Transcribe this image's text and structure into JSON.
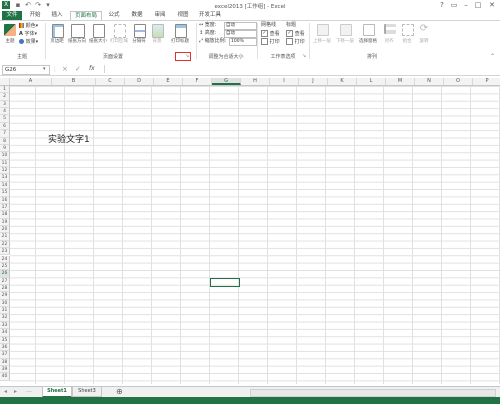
{
  "window": {
    "title": "excel2013 [工作组] - Excel",
    "quick_access": [
      "save-icon",
      "undo-icon",
      "redo-icon",
      "customize-icon"
    ],
    "controls": [
      "help-icon",
      "ribbon-display-icon",
      "minimize-icon",
      "restore-icon",
      "close-icon"
    ]
  },
  "tabs": {
    "file": "文件",
    "items": [
      "开始",
      "插入",
      "页面布局",
      "公式",
      "数据",
      "审阅",
      "视图",
      "开发工具"
    ],
    "active": "页面布局"
  },
  "ribbon": {
    "themes": {
      "label": "主题",
      "big_button": "主题",
      "colors": "颜色",
      "fonts": "字体",
      "effects": "效果"
    },
    "page_setup": {
      "label": "页面设置",
      "margins": "页边距",
      "orientation": "纸张方向",
      "size": "纸张大小",
      "print_area": "打印区域",
      "breaks": "分隔符",
      "background": "背景",
      "print_titles": "打印标题"
    },
    "scale_to_fit": {
      "label": "调整为合适大小",
      "width_label": "宽度:",
      "width_value": "自动",
      "height_label": "高度:",
      "height_value": "自动",
      "scale_label": "缩放比例:",
      "scale_value": "100%"
    },
    "sheet_options": {
      "label": "工作表选项",
      "gridlines": "网格线",
      "headings": "标题",
      "view": "查看",
      "print": "打印",
      "gridlines_view": true,
      "headings_view": true,
      "gridlines_print": false,
      "headings_print": false
    },
    "arrange": {
      "label": "排列",
      "bring_forward": "上移一层",
      "send_backward": "下移一层",
      "selection_pane": "选择窗格",
      "align": "对齐",
      "group": "组合",
      "rotate": "旋转"
    }
  },
  "formula_bar": {
    "name_box": "G26",
    "fx": "fx",
    "cancel": "×",
    "enter": "✓",
    "content": ""
  },
  "grid": {
    "columns": [
      "A",
      "B",
      "C",
      "D",
      "E",
      "F",
      "G",
      "H",
      "I",
      "J",
      "K",
      "L",
      "M",
      "N",
      "O",
      "P"
    ],
    "selected_column": "G",
    "rows": [
      "1",
      "2",
      "3",
      "4",
      "5",
      "6",
      "7",
      "8",
      "9",
      "10",
      "11",
      "12",
      "13",
      "14",
      "15",
      "16",
      "17",
      "18",
      "19",
      "20",
      "21",
      "22",
      "23",
      "24",
      "25",
      "26",
      "27",
      "28",
      "29",
      "30",
      "31",
      "32",
      "33",
      "34",
      "35",
      "36",
      "37",
      "38",
      "39",
      "40"
    ],
    "selected_row": "26",
    "cell_text": "实验文字1"
  },
  "sheets": {
    "tabs": [
      "Sheet1",
      "Sheet3"
    ],
    "active": "Sheet1",
    "add": "⊕"
  },
  "colors": {
    "accent": "#217346",
    "highlight_box": "#e03030"
  }
}
